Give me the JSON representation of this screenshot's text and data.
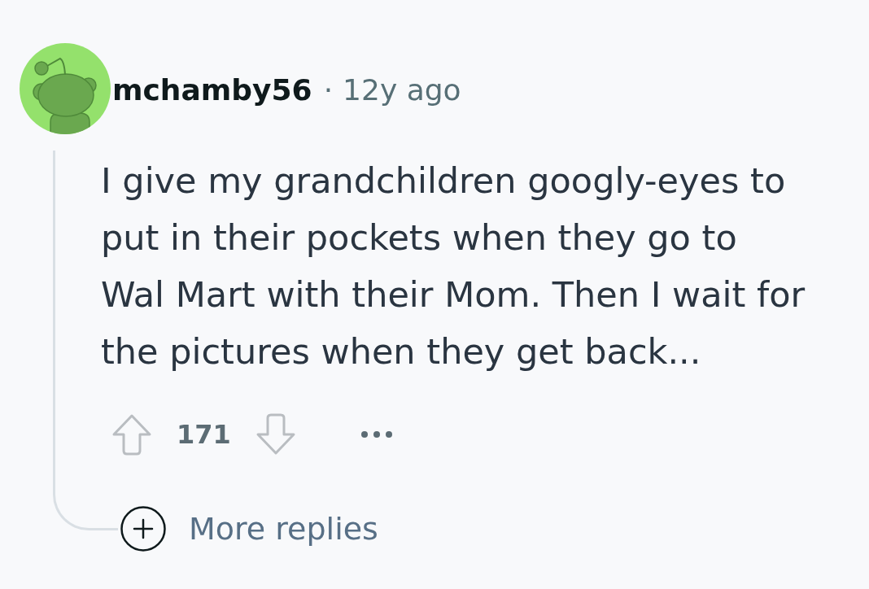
{
  "comment": {
    "author": "mchamby56",
    "separator": "·",
    "time": "12y ago",
    "body": "I give my grandchildren googly-eyes to put in their pockets when they go to Wal Mart with their Mom. Then I wait for the pictures when they get back...",
    "score": "171",
    "more_replies": "More replies"
  }
}
